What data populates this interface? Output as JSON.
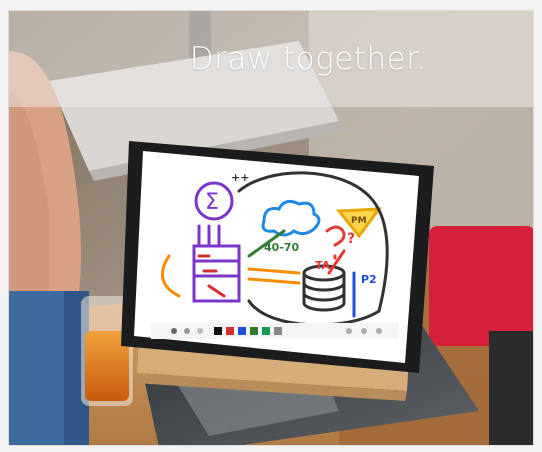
{
  "banner": {
    "caption": "Draw together."
  },
  "whiteboard": {
    "annotations": {
      "range": "40-70",
      "triangle": "PM",
      "question": "?",
      "cylinder": "TA",
      "side": "P2",
      "stars": "++"
    }
  },
  "palette": {
    "colors": [
      "#111111",
      "#d32f2f",
      "#1e4fd8",
      "#2e7d32",
      "#0f9d58",
      "#888888"
    ]
  }
}
